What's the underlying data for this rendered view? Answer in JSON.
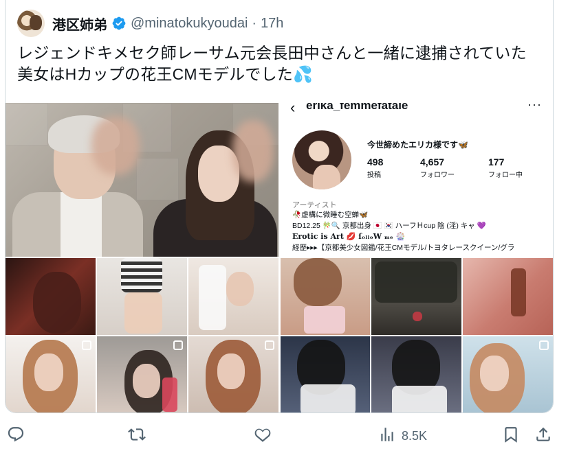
{
  "tweet": {
    "display_name": "港区姉弟",
    "handle": "@minatokukyoudai",
    "separator": "·",
    "time": "17h",
    "text_line1": "レジェンドキメセク師レーサム元会長田中さんと一緒に逮捕されていた",
    "text_line2": "美女はHカップの花王CMモデルでした",
    "emoji": "💦"
  },
  "profile": {
    "back_glyph": "‹",
    "username": "erika_femmefatale",
    "more_glyph": "···",
    "display_name": "今世諦めたエリカ様です🦋",
    "stats": [
      {
        "value": "498",
        "label": "投稿"
      },
      {
        "value": "4,657",
        "label": "フォロワー"
      },
      {
        "value": "177",
        "label": "フォロー中"
      }
    ],
    "category": "アーティスト",
    "bio": [
      "🥀虚構に微睡む空蝉🦋",
      "BD12.25 🎋🔍 京都出身 🇯🇵 🇰🇷 ハーフＨcup 陰 (淫) キャ 💜",
      "Erotic is Art 💋   ſₒₗₗₒW ₘₑ 🎡",
      "経歴▸▸▸【京都美少女図鑑/花王CMモデル/トヨタレースクイーン/グラ"
    ]
  },
  "actions": {
    "reply_count": "",
    "retweet_count": "",
    "like_count": "",
    "views": "8.5K"
  },
  "colors": {
    "accent": "#1d9bf0",
    "text": "#0f1419",
    "muted": "#536471",
    "border": "#cfd9de"
  },
  "icons": [
    "verified-badge-icon",
    "reply-icon",
    "retweet-icon",
    "like-icon",
    "views-icon",
    "bookmark-icon",
    "share-icon",
    "multi-photo-icon"
  ]
}
